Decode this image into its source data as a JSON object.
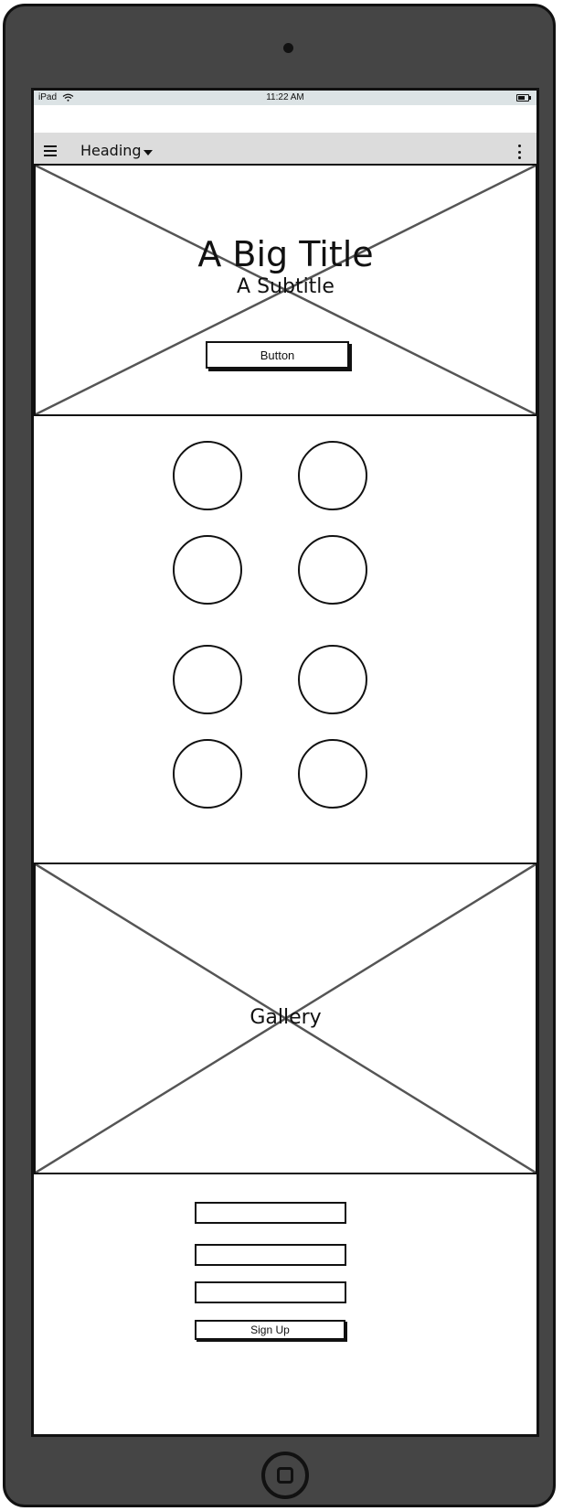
{
  "status_bar": {
    "device": "iPad",
    "time": "11:22 AM"
  },
  "nav": {
    "heading": "Heading",
    "menu_icon": "hamburger-icon",
    "dropdown_icon": "caret-down-icon",
    "more_icon": "kebab-icon"
  },
  "hero": {
    "title": "A Big Title",
    "subtitle": "A Subtitle",
    "button_label": "Button"
  },
  "circles": {
    "count": 8
  },
  "gallery": {
    "label": "Gallery"
  },
  "signup": {
    "fields": [
      "",
      "",
      ""
    ],
    "button_label": "Sign Up"
  }
}
